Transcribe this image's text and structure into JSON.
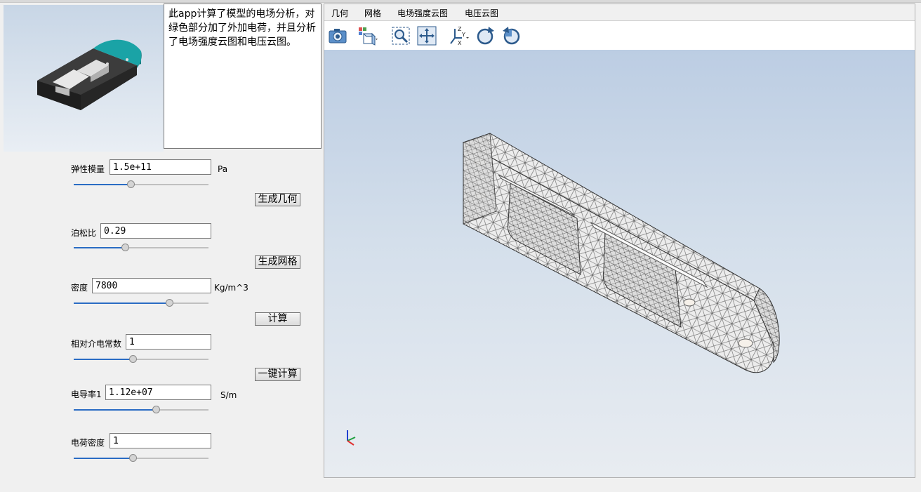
{
  "description": {
    "text": "此app计算了模型的电场分析，对绿色部分加了外加电荷，并且分析了电场强度云图和电压云图。"
  },
  "params": [
    {
      "label": "弹性模量",
      "value": "1.5e+11",
      "unit": "Pa",
      "slider": 0.42
    },
    {
      "label": "泊松比",
      "value": "0.29",
      "unit": "",
      "slider": 0.38
    },
    {
      "label": "密度",
      "value": "7800",
      "unit": "Kg/m^3",
      "slider": 0.71
    },
    {
      "label": "相对介电常数",
      "value": "1",
      "unit": "",
      "slider": 0.44
    },
    {
      "label": "电导率1",
      "value": "1.12e+07",
      "unit": "S/m",
      "slider": 0.61
    },
    {
      "label": "电荷密度",
      "value": "1",
      "unit": "",
      "slider": 0.44
    }
  ],
  "buttons": {
    "geometry": "生成几何",
    "mesh": "生成网格",
    "compute": "计算",
    "one_click": "一键计算"
  },
  "tabs": [
    "几何",
    "网格",
    "电场强度云图",
    "电压云图"
  ],
  "toolbar_icons": [
    "camera-icon",
    "view-cube-icon",
    "zoom-box-icon",
    "zoom-extents-icon",
    "axes-orientation-icon",
    "rotate-left-icon",
    "rotate-right-icon"
  ],
  "colors": {
    "slider_fill": "#2a6cc4",
    "teal_part": "#1aa3a6",
    "model_dark": "#3a3a3a"
  }
}
